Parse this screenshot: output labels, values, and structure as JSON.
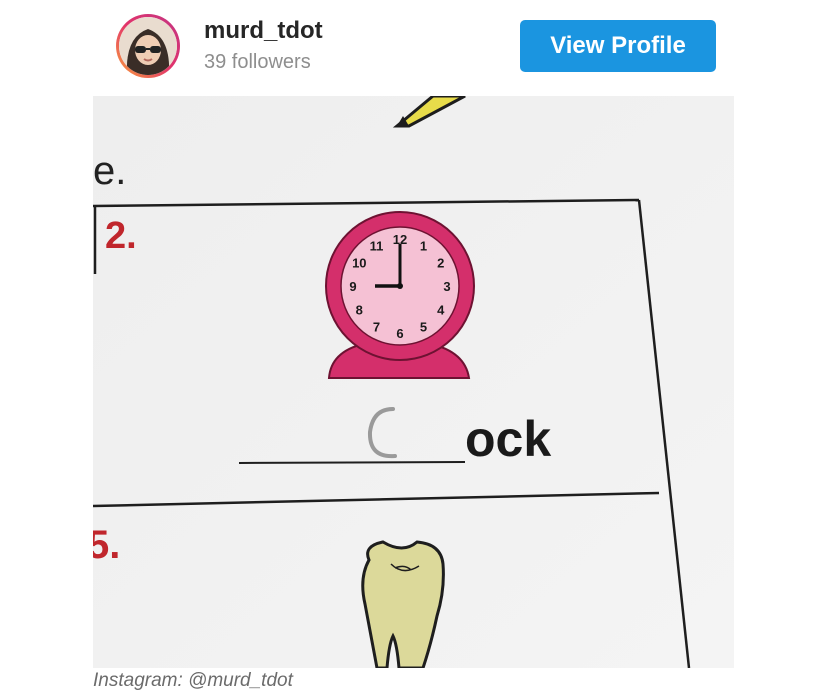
{
  "profile": {
    "username": "murd_tdot",
    "followers": "39 followers",
    "view_profile_label": "View Profile"
  },
  "worksheet": {
    "fragment_text": "e.",
    "item_2_number": "2.",
    "item_5_number": "5.",
    "word_suffix": "ock",
    "clock_numbers": [
      "12",
      "1",
      "2",
      "3",
      "4",
      "5",
      "6",
      "7",
      "8",
      "9",
      "10",
      "11"
    ],
    "clock_time": "9:00"
  },
  "caption": "Instagram: @murd_tdot",
  "colors": {
    "button": "#1b95e0",
    "clock_body": "#d42f6b",
    "clock_face": "#f5c1d4",
    "item_number": "#c0262c",
    "tooth": "#dcd99a"
  }
}
